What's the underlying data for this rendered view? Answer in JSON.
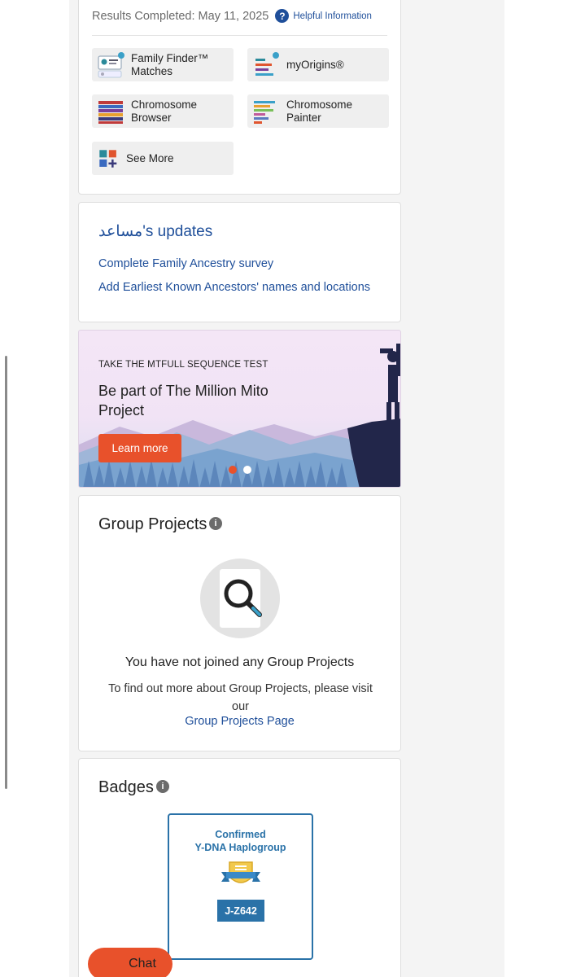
{
  "results": {
    "completed_text": "Results Completed: May 11, 2025",
    "help_icon": "?",
    "help_link": "Helpful Information",
    "tools": [
      {
        "label_line1": "Family Finder™",
        "label_line2": "Matches",
        "icon": "family-finder-icon"
      },
      {
        "label_line1": "myOrigins®",
        "label_line2": "",
        "icon": "myorigins-icon"
      },
      {
        "label_line1": "Chromosome",
        "label_line2": "Browser",
        "icon": "chromosome-browser-icon"
      },
      {
        "label_line1": "Chromosome",
        "label_line2": "Painter",
        "icon": "chromosome-painter-icon"
      },
      {
        "label_line1": "See More",
        "label_line2": "",
        "icon": "see-more-icon"
      }
    ]
  },
  "updates": {
    "title": "مساعد's updates",
    "links": [
      "Complete Family Ancestry survey",
      "Add Earliest Known Ancestors' names and locations"
    ]
  },
  "banner": {
    "kicker": "TAKE THE MTFULL SEQUENCE TEST",
    "title": "Be part of The Million Mito Project",
    "button": "Learn more",
    "active_slide": 1,
    "slide_count": 2
  },
  "group_projects": {
    "title": "Group Projects",
    "info_icon": "i",
    "empty_title": "You have not joined any Group Projects",
    "empty_text": "To find out more about Group Projects, please visit our",
    "link": "Group Projects Page"
  },
  "badges": {
    "title": "Badges",
    "info_icon": "i",
    "items": [
      {
        "title_line1": "Confirmed",
        "title_line2": "Y-DNA Haplogroup",
        "tag": "J-Z642"
      }
    ]
  },
  "chat": {
    "label": "Chat"
  },
  "colors": {
    "accent": "#1f4f9a",
    "cta": "#e8512b",
    "badge": "#2a72a8"
  }
}
